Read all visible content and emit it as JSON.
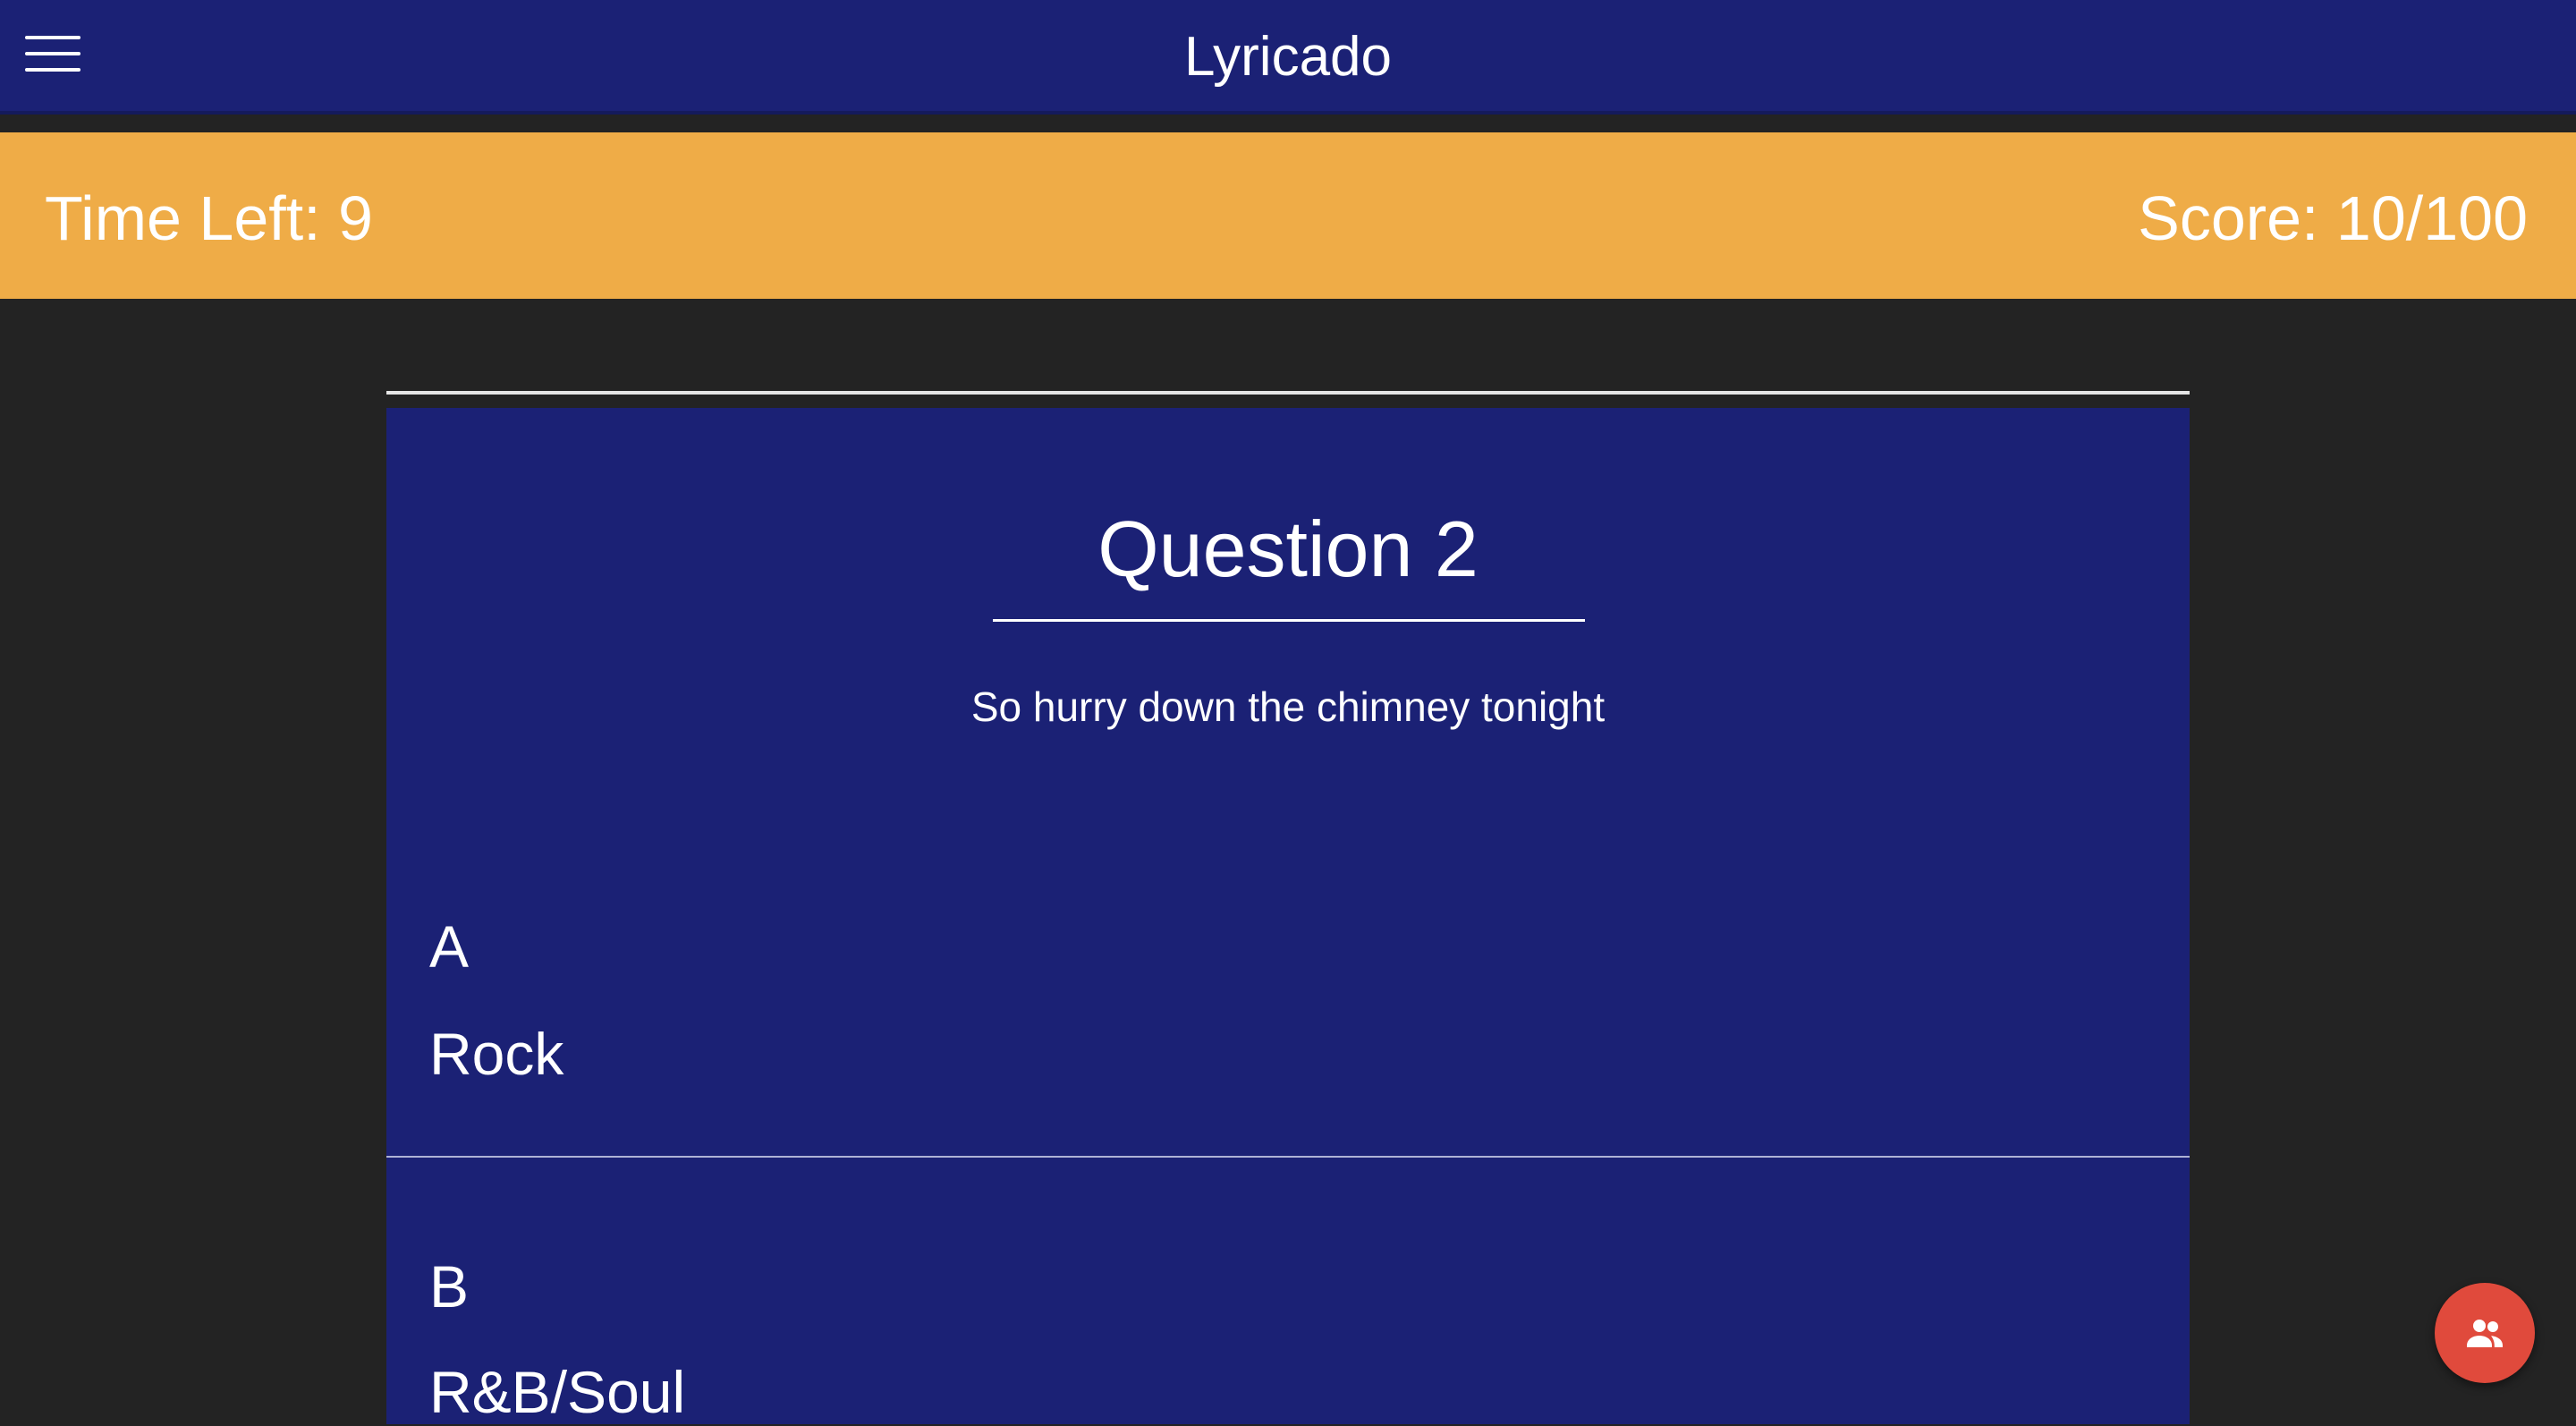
{
  "header": {
    "title": "Lyricado",
    "menu_icon": "hamburger-menu-icon"
  },
  "status": {
    "time_left": "Time Left: 9",
    "score": "Score: 10/100"
  },
  "question": {
    "title": "Question 2",
    "lyric": "So hurry down the chimney tonight"
  },
  "answers": [
    {
      "letter": "A",
      "genre": "Rock"
    },
    {
      "letter": "B",
      "genre": "R&B/Soul"
    }
  ],
  "fab": {
    "icon": "people-icon"
  },
  "colors": {
    "header_bg": "#1b2175",
    "status_bg": "#efac47",
    "page_bg": "#232323",
    "fab_bg": "#e04a3c"
  }
}
